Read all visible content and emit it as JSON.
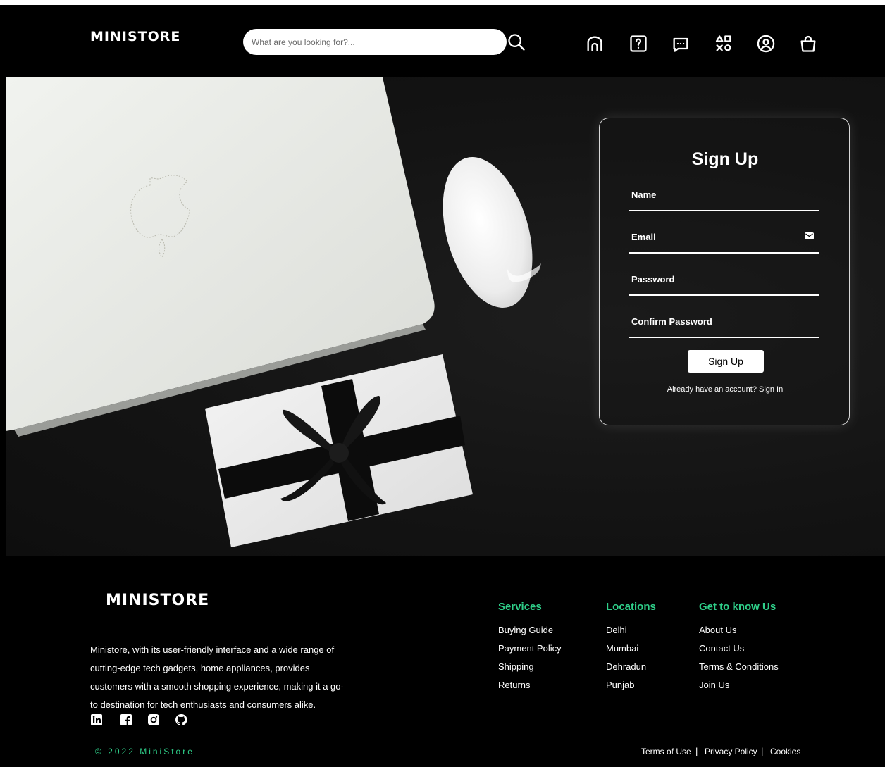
{
  "brand": {
    "name": "MINISTORE"
  },
  "search": {
    "placeholder": "What are you looking for?..."
  },
  "nav_icons": [
    "search-icon",
    "home-icon",
    "help-icon",
    "chat-icon",
    "categories-icon",
    "account-icon",
    "cart-icon"
  ],
  "signup": {
    "title": "Sign Up",
    "fields": [
      {
        "label": "Name",
        "icon": null
      },
      {
        "label": "Email",
        "icon": "mail-icon"
      },
      {
        "label": "Password",
        "icon": null
      },
      {
        "label": "Confirm Password",
        "icon": null
      }
    ],
    "button_label": "Sign Up",
    "signin_prompt": "Already have an account? Sign In"
  },
  "footer": {
    "logo": "MINISTORE",
    "description_lines": [
      "Ministore, with its user-friendly interface and a wide range of",
      "cutting-edge tech gadgets, home appliances, provides",
      "customers with a smooth shopping experience, making it a go-",
      "to destination for tech enthusiasts and consumers alike."
    ],
    "social_icons": [
      "linkedin-icon",
      "facebook-icon",
      "instagram-icon",
      "github-icon"
    ],
    "columns": [
      {
        "heading": "Services",
        "links": [
          "Buying Guide",
          "Payment Policy",
          "Shipping",
          "Returns"
        ]
      },
      {
        "heading": "Locations",
        "links": [
          "Delhi",
          "Mumbai",
          "Dehradun",
          "Punjab"
        ]
      },
      {
        "heading": "Get to know Us",
        "links": [
          "About Us",
          "Contact Us",
          "Terms & Conditions",
          "Join Us"
        ]
      }
    ],
    "copyright": "© 2022 MiniStore",
    "legal_links": [
      "Terms of Use",
      "Privacy Policy",
      "Cookies"
    ],
    "separator": "|"
  },
  "colors": {
    "accent": "#2fd08a",
    "background": "#000000",
    "card_border": "#d9d9d9"
  }
}
